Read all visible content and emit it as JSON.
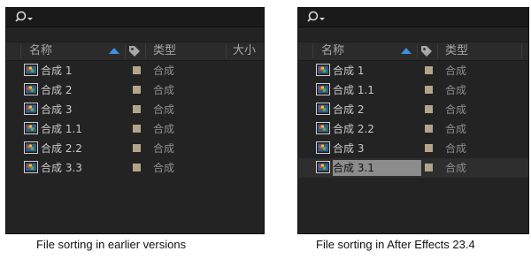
{
  "left_panel": {
    "search_placeholder": "",
    "columns": {
      "name": "名称",
      "type": "类型",
      "size": "大小"
    },
    "rows": [
      {
        "name": "合成 1",
        "type": "合成"
      },
      {
        "name": "合成 2",
        "type": "合成"
      },
      {
        "name": "合成 3",
        "type": "合成"
      },
      {
        "name": "合成 1.1",
        "type": "合成"
      },
      {
        "name": "合成 2.2",
        "type": "合成"
      },
      {
        "name": "合成 3.3",
        "type": "合成"
      }
    ]
  },
  "right_panel": {
    "search_placeholder": "",
    "columns": {
      "name": "名称",
      "type": "类型"
    },
    "rows": [
      {
        "name": "合成 1",
        "type": "合成"
      },
      {
        "name": "合成 1.1",
        "type": "合成"
      },
      {
        "name": "合成 2",
        "type": "合成"
      },
      {
        "name": "合成 2.2",
        "type": "合成"
      },
      {
        "name": "合成 3",
        "type": "合成"
      },
      {
        "name": "合成 3.1",
        "type": "合成",
        "selected": true
      }
    ]
  },
  "captions": {
    "left": "File sorting in earlier versions",
    "right": "File sorting in After Effects 23.4"
  },
  "colors": {
    "panel_bg": "#232323",
    "label_swatch": "#b3a48a",
    "sort_arrow": "#3e8ee6"
  },
  "icons": {
    "search": "search-icon",
    "label": "label-tag-icon",
    "composition": "composition-icon"
  }
}
